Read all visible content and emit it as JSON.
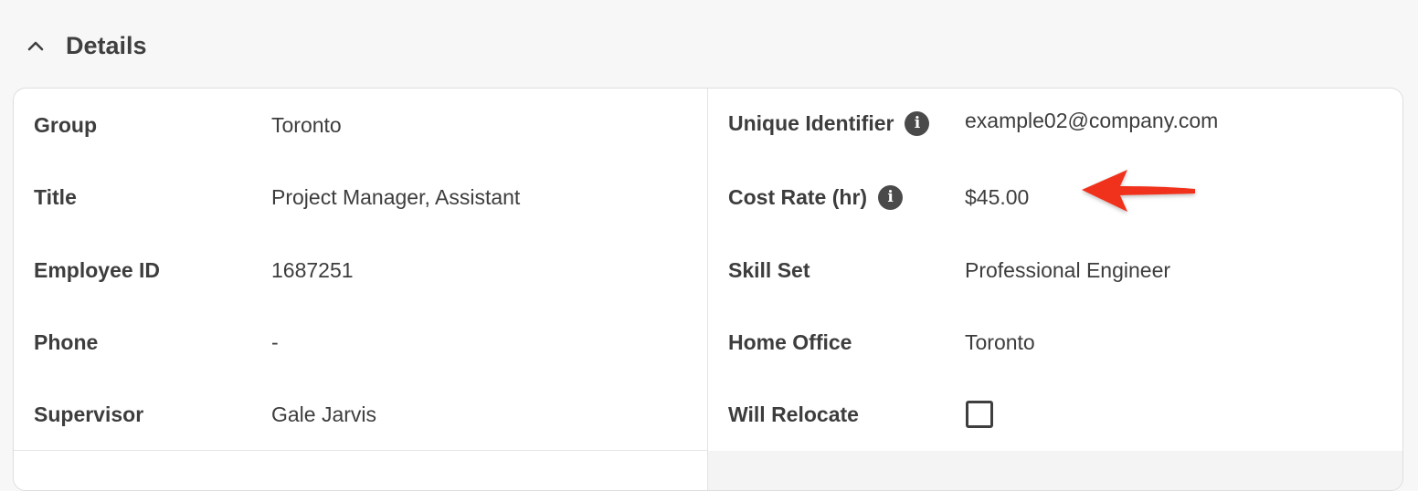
{
  "section": {
    "title": "Details",
    "toggle_icon": "chevron-up-icon"
  },
  "left": [
    {
      "key": "group",
      "label": "Group",
      "value": "Toronto"
    },
    {
      "key": "title",
      "label": "Title",
      "value": "Project Manager, Assistant"
    },
    {
      "key": "employee-id",
      "label": "Employee ID",
      "value": "1687251"
    },
    {
      "key": "phone",
      "label": "Phone",
      "value": "-"
    },
    {
      "key": "supervisor",
      "label": "Supervisor",
      "value": "Gale Jarvis"
    }
  ],
  "right": [
    {
      "key": "unique-identifier",
      "label": "Unique Identifier",
      "value": "example02@company.com",
      "info": true
    },
    {
      "key": "cost-rate",
      "label": "Cost Rate (hr)",
      "value": "$45.00",
      "info": true
    },
    {
      "key": "skill-set",
      "label": "Skill Set",
      "value": "Professional Engineer"
    },
    {
      "key": "home-office",
      "label": "Home Office",
      "value": "Toronto"
    },
    {
      "key": "will-relocate",
      "label": "Will Relocate",
      "checked": false
    }
  ],
  "info_glyph": "i",
  "annotation": {
    "icon": "red-arrow-icon",
    "color": "#f0311f"
  }
}
